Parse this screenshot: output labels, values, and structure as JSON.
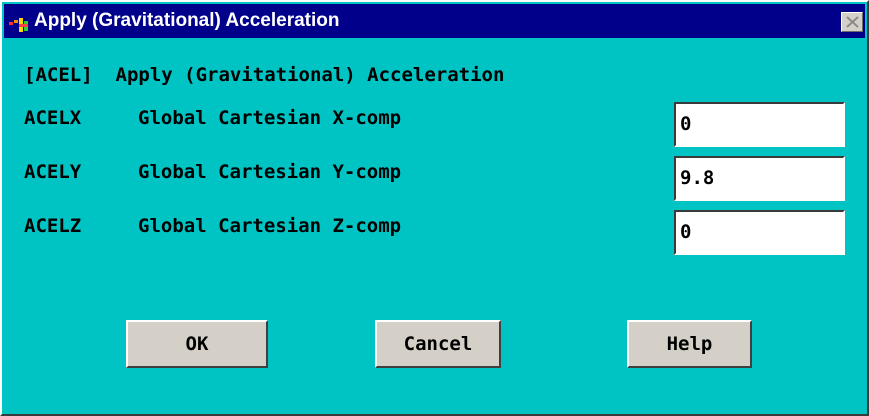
{
  "window": {
    "title": "Apply (Gravitational) Acceleration",
    "icons": {
      "app": "ansys-app-icon",
      "close": "close-icon"
    },
    "colors": {
      "title_bar": "#00008b",
      "title_text": "#ffffff",
      "background": "#00c4c4",
      "button_face": "#d4d0c8",
      "field_background": "#ffffff"
    }
  },
  "dialog": {
    "heading": "[ACEL]  Apply (Gravitational) Acceleration",
    "fields": [
      {
        "code": "ACELX",
        "label": "Global Cartesian X-comp",
        "value": "0"
      },
      {
        "code": "ACELY",
        "label": "Global Cartesian Y-comp",
        "value": "9.8"
      },
      {
        "code": "ACELZ",
        "label": "Global Cartesian Z-comp",
        "value": "0"
      }
    ]
  },
  "buttons": {
    "ok": "OK",
    "cancel": "Cancel",
    "help": "Help"
  }
}
